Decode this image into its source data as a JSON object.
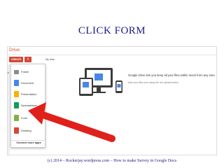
{
  "slide": {
    "title": "CLICK FORM",
    "footer": "(c) 2014 – Rockerjay.wordpress.com – How to make Survey in Google Docs"
  },
  "drive": {
    "app_title": "Drive",
    "create_label": "CREATE",
    "upload_icon": "upload-icon",
    "breadcrumb": "My drive",
    "menu": {
      "items": [
        {
          "label": "Folder",
          "icon": "folder-icon"
        },
        {
          "label": "Document",
          "icon": "document-icon"
        },
        {
          "label": "Presentation",
          "icon": "presentation-icon"
        },
        {
          "label": "Spreadsheet",
          "icon": "spreadsheet-icon"
        },
        {
          "label": "Form",
          "icon": "form-icon"
        },
        {
          "label": "Drawing",
          "icon": "drawing-icon"
        }
      ],
      "connect_label": "Connect more apps"
    },
    "promo": {
      "headline": "Google Drive lets you keep all your files within reach from any sma",
      "subtext": "Add your files now using the red upload button"
    }
  },
  "colors": {
    "accent_red": "#d14836",
    "arrow_red": "#e0201a",
    "title_blue": "#1a1a8c"
  }
}
